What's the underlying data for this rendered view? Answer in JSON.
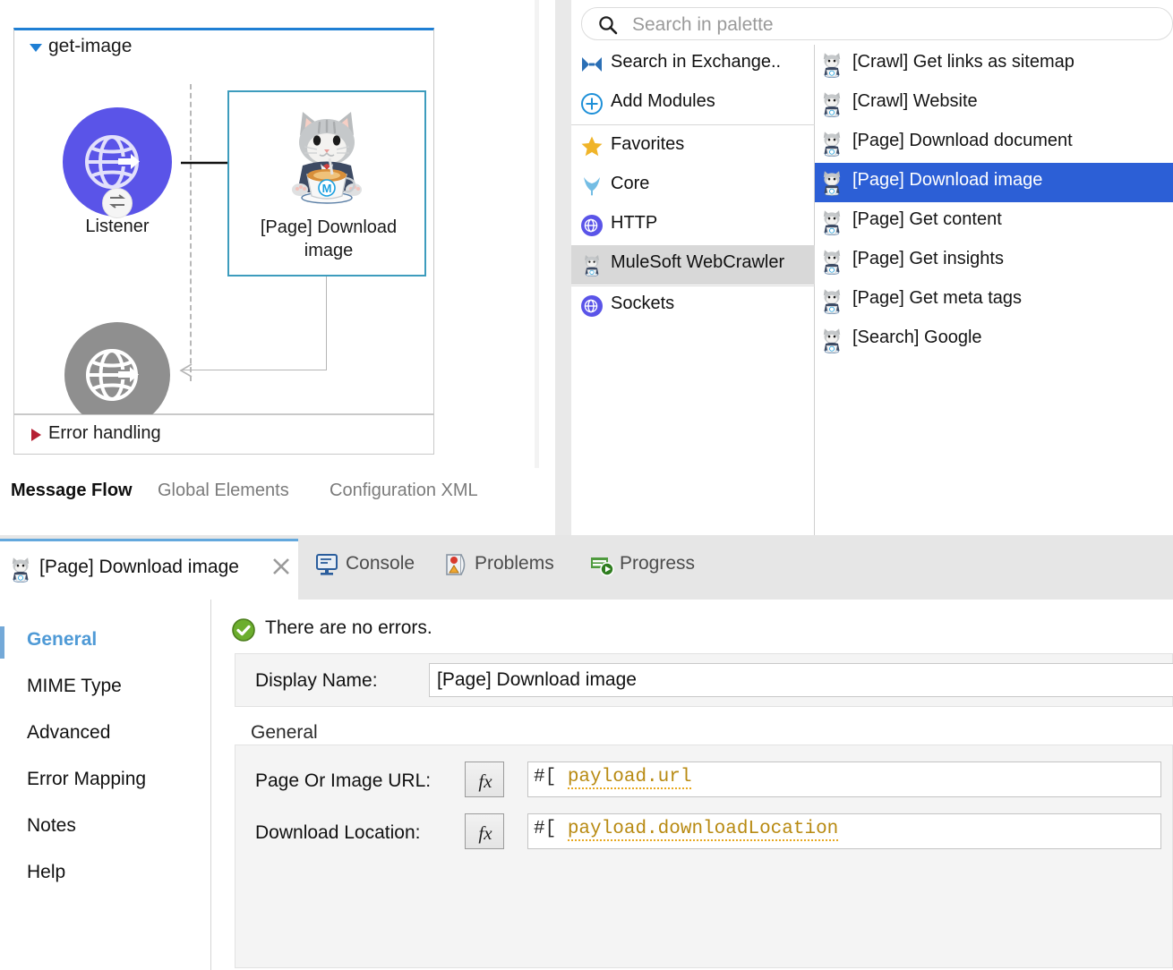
{
  "canvas": {
    "flow_name": "get-image",
    "flow_caret": "triangle-down-icon",
    "listener": {
      "label": "Listener",
      "icon": "http-listener-globe-icon",
      "badge": "exchange-arrows-icon",
      "color": "#5a54e8"
    },
    "node": {
      "label": "[Page] Download image",
      "icon": "mulesoft-webcrawler-cat-icon",
      "border_color": "#3d9cbd",
      "selected": true
    },
    "response": {
      "icon": "http-response-globe-icon",
      "color": "#8f8f8f"
    },
    "error_handling": {
      "label": "Error handling",
      "caret": "triangle-right-icon",
      "caret_color": "#b62034"
    },
    "editor_tabs": [
      {
        "label": "Message Flow",
        "active": true
      },
      {
        "label": "Global Elements",
        "active": false
      },
      {
        "label": "Configuration XML",
        "active": false
      }
    ]
  },
  "palette": {
    "search": {
      "placeholder": "Search in palette",
      "value": "",
      "icon": "search-icon"
    },
    "categories": [
      {
        "label": "Search in Exchange..",
        "icon": "exchange-icon",
        "selected": false
      },
      {
        "label": "Add Modules",
        "icon": "plus-circle-icon",
        "selected": false
      },
      {
        "label": "Favorites",
        "icon": "star-icon",
        "selected": false
      },
      {
        "label": "Core",
        "icon": "mule-ears-icon",
        "selected": false
      },
      {
        "label": "HTTP",
        "icon": "globe-purple-icon",
        "selected": false
      },
      {
        "label": "MuleSoft WebCrawler",
        "icon": "webcrawler-cat-icon",
        "selected": true
      },
      {
        "label": "Sockets",
        "icon": "globe-purple-icon",
        "selected": false
      }
    ],
    "operations": [
      {
        "label": "[Crawl] Get links as sitemap",
        "icon": "webcrawler-cat-icon",
        "selected": false
      },
      {
        "label": "[Crawl] Website",
        "icon": "webcrawler-cat-icon",
        "selected": false
      },
      {
        "label": "[Page] Download document",
        "icon": "webcrawler-cat-icon",
        "selected": false
      },
      {
        "label": "[Page] Download image",
        "icon": "webcrawler-cat-icon",
        "selected": true
      },
      {
        "label": "[Page] Get content",
        "icon": "webcrawler-cat-icon",
        "selected": false
      },
      {
        "label": "[Page] Get insights",
        "icon": "webcrawler-cat-icon",
        "selected": false
      },
      {
        "label": "[Page] Get meta tags",
        "icon": "webcrawler-cat-icon",
        "selected": false
      },
      {
        "label": "[Search] Google",
        "icon": "webcrawler-cat-icon",
        "selected": false
      }
    ],
    "selection_color": "#2c5fd6"
  },
  "bottom_panel": {
    "active_tab": {
      "label": "[Page] Download image",
      "icon": "webcrawler-cat-icon",
      "close": "close-icon"
    },
    "tabs": [
      {
        "label": "Console",
        "icon": "console-monitor-icon"
      },
      {
        "label": "Problems",
        "icon": "problems-marker-icon"
      },
      {
        "label": "Progress",
        "icon": "progress-icon"
      }
    ]
  },
  "properties": {
    "sidebar": [
      {
        "label": "General",
        "active": true
      },
      {
        "label": "MIME Type",
        "active": false
      },
      {
        "label": "Advanced",
        "active": false
      },
      {
        "label": "Error Mapping",
        "active": false
      },
      {
        "label": "Notes",
        "active": false
      },
      {
        "label": "Help",
        "active": false
      }
    ],
    "status": {
      "text": "There are no errors.",
      "icon": "success-check-icon"
    },
    "display_name": {
      "label": "Display Name:",
      "value": "[Page] Download image"
    },
    "section_title": "General",
    "fields": [
      {
        "label": "Page Or Image URL:",
        "fx": "fx-button",
        "prefix": "#[",
        "expression": "payload.url"
      },
      {
        "label": "Download Location:",
        "fx": "fx-button",
        "prefix": "#[",
        "expression": "payload.downloadLocation"
      }
    ],
    "accent_color": "#4f9ad6"
  }
}
